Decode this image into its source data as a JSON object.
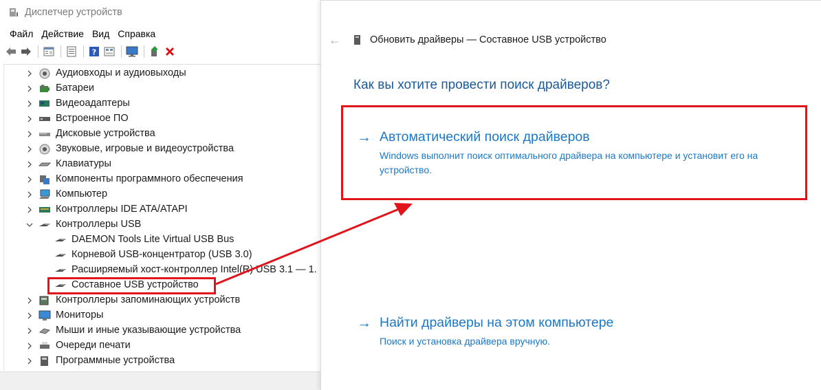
{
  "window": {
    "title": "Диспетчер устройств"
  },
  "menu": {
    "items": [
      "Файл",
      "Действие",
      "Вид",
      "Справка"
    ]
  },
  "toolbar": {
    "buttons": [
      "back-icon",
      "forward-icon",
      "properties-icon",
      "show-hidden-icon",
      "help-icon",
      "resources-icon",
      "monitor-icon",
      "update-driver-icon",
      "uninstall-icon"
    ]
  },
  "tree": {
    "items": [
      {
        "label": "Аудиовходы и аудиовыходы",
        "icon": "speaker-icon",
        "level": 0,
        "expanded": false
      },
      {
        "label": "Батареи",
        "icon": "battery-icon",
        "level": 0,
        "expanded": false
      },
      {
        "label": "Видеоадаптеры",
        "icon": "display-adapter-icon",
        "level": 0,
        "expanded": false
      },
      {
        "label": "Встроенное ПО",
        "icon": "firmware-icon",
        "level": 0,
        "expanded": false
      },
      {
        "label": "Дисковые устройства",
        "icon": "disk-drive-icon",
        "level": 0,
        "expanded": false
      },
      {
        "label": "Звуковые, игровые и видеоустройства",
        "icon": "sound-icon",
        "level": 0,
        "expanded": false
      },
      {
        "label": "Клавиатуры",
        "icon": "keyboard-icon",
        "level": 0,
        "expanded": false
      },
      {
        "label": "Компоненты программного обеспечения",
        "icon": "software-component-icon",
        "level": 0,
        "expanded": false
      },
      {
        "label": "Компьютер",
        "icon": "computer-icon",
        "level": 0,
        "expanded": false
      },
      {
        "label": "Контроллеры IDE ATA/ATAPI",
        "icon": "ide-controller-icon",
        "level": 0,
        "expanded": false
      },
      {
        "label": "Контроллеры USB",
        "icon": "usb-icon",
        "level": 0,
        "expanded": true
      },
      {
        "label": "DAEMON Tools Lite Virtual USB Bus",
        "icon": "usb-icon",
        "level": 1
      },
      {
        "label": "Корневой USB-концентратор (USB 3.0)",
        "icon": "usb-icon",
        "level": 1
      },
      {
        "label": "Расширяемый хост-контроллер Intel(R) USB 3.1 — 1.",
        "icon": "usb-icon",
        "level": 1
      },
      {
        "label": "Составное USB устройство",
        "icon": "usb-icon",
        "level": 1
      },
      {
        "label": "Контроллеры запоминающих устройств",
        "icon": "storage-controller-icon",
        "level": 0,
        "expanded": false
      },
      {
        "label": "Мониторы",
        "icon": "monitor-icon",
        "level": 0,
        "expanded": false
      },
      {
        "label": "Мыши и иные указывающие устройства",
        "icon": "mouse-icon",
        "level": 0,
        "expanded": false
      },
      {
        "label": "Очереди печати",
        "icon": "printer-icon",
        "level": 0,
        "expanded": false
      },
      {
        "label": "Программные устройства",
        "icon": "software-device-icon",
        "level": 0,
        "expanded": false
      }
    ]
  },
  "panel": {
    "header_title": "Обновить драйверы — Составное USB устройство",
    "question": "Как вы хотите провести поиск драйверов?",
    "options": [
      {
        "title": "Автоматический поиск драйверов",
        "description": "Windows выполнит поиск оптимального драйвера на компьютере и установит его на устройство."
      },
      {
        "title": "Найти драйверы на этом компьютере",
        "description": "Поиск и установка драйвера вручную."
      }
    ]
  },
  "colors": {
    "link_blue": "#1a78c8",
    "heading_blue": "#1a5a9a",
    "annotation_red": "#e1141b"
  }
}
